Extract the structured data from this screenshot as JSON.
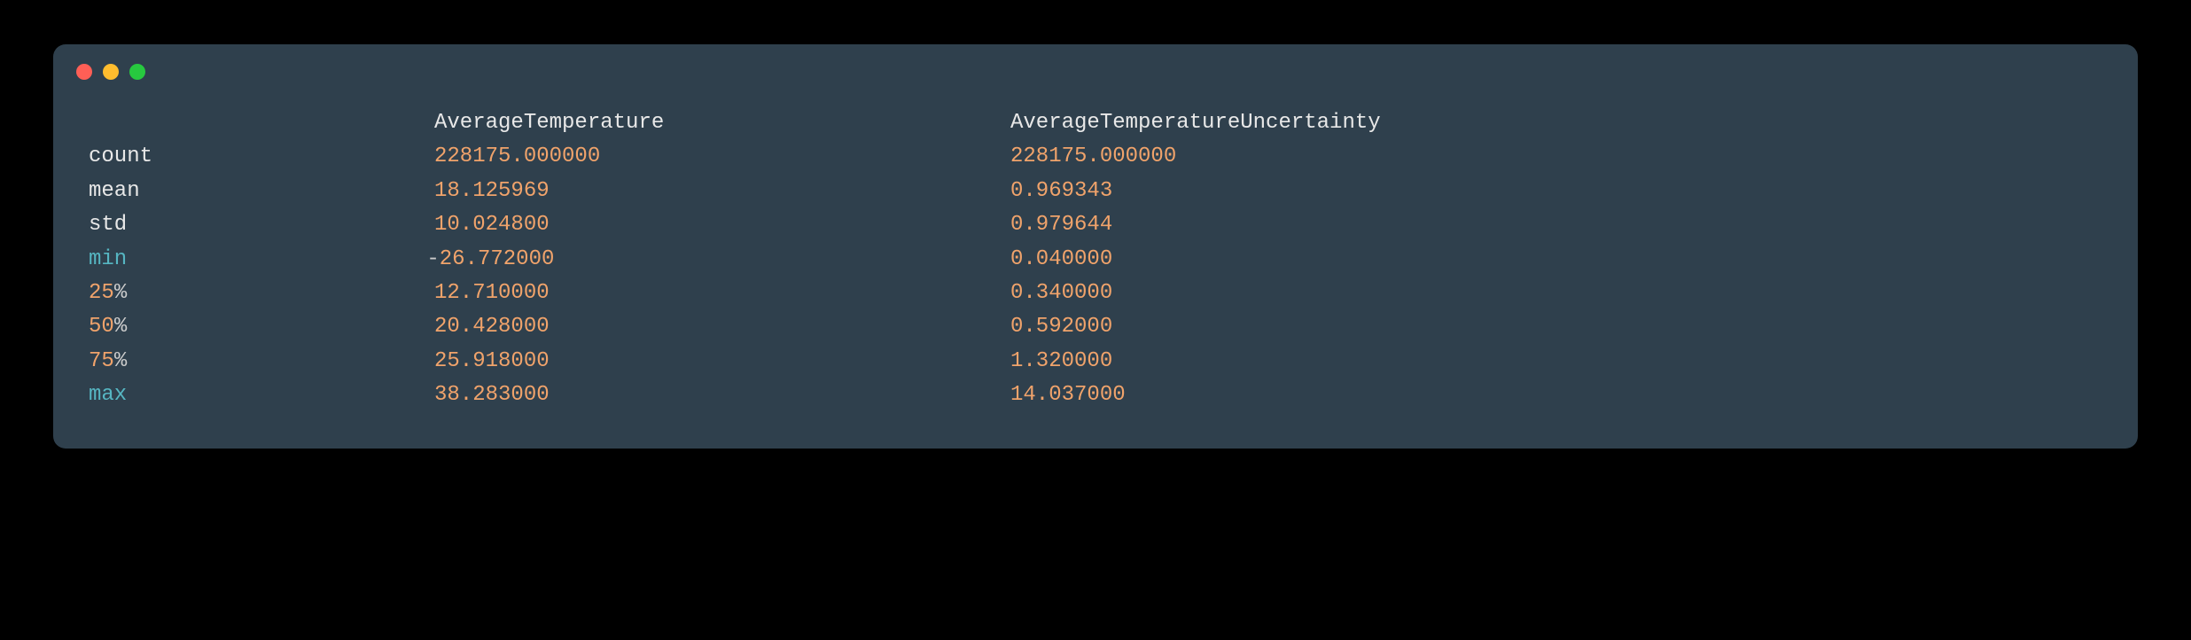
{
  "headers": {
    "col1": "AverageTemperature",
    "col2": "AverageTemperatureUncertainty"
  },
  "rows": [
    {
      "label": "count",
      "labelClass": "c-white",
      "v1_prefix": "",
      "v1": "228175.000000",
      "v2": "228175.000000"
    },
    {
      "label": "mean",
      "labelClass": "c-white",
      "v1_prefix": "",
      "v1": "18.125969",
      "v2": "0.969343"
    },
    {
      "label": "std",
      "labelClass": "c-white",
      "v1_prefix": "",
      "v1": "10.024800",
      "v2": "0.979644"
    },
    {
      "label": "min",
      "labelClass": "c-cyan",
      "v1_prefix": "-",
      "v1": "26.772000",
      "v2": "0.040000"
    },
    {
      "label": "25",
      "labelSuffix": "%",
      "labelClass": "c-orange",
      "v1_prefix": "",
      "v1": "12.710000",
      "v2": "0.340000"
    },
    {
      "label": "50",
      "labelSuffix": "%",
      "labelClass": "c-orange",
      "v1_prefix": "",
      "v1": "20.428000",
      "v2": "0.592000"
    },
    {
      "label": "75",
      "labelSuffix": "%",
      "labelClass": "c-orange",
      "v1_prefix": "",
      "v1": "25.918000",
      "v2": "1.320000"
    },
    {
      "label": "max",
      "labelClass": "c-cyan",
      "v1_prefix": "",
      "v1": "38.283000",
      "v2": "14.037000"
    }
  ]
}
